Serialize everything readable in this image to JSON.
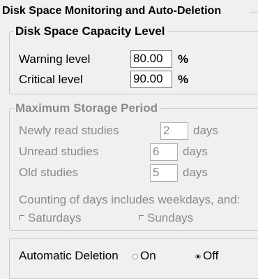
{
  "outer": {
    "title": "Disk Space Monitoring and Auto-Deletion"
  },
  "capacity": {
    "title": "Disk Space Capacity Level",
    "warning_label": "Warning level",
    "warning_value": "80.00",
    "critical_label": "Critical level",
    "critical_value": "90.00",
    "unit": "%"
  },
  "storage": {
    "title": "Maximum Storage Period",
    "newly_label": "Newly read studies",
    "newly_value": "2",
    "unread_label": "Unread studies",
    "unread_value": "6",
    "old_label": "Old studies",
    "old_value": "5",
    "days_unit": "days",
    "counting_text": "Counting of days includes weekdays, and:",
    "saturdays_label": "Saturdays",
    "sundays_label": "Sundays"
  },
  "auto_deletion": {
    "label": "Automatic Deletion",
    "on_label": "On",
    "off_label": "Off",
    "selected": "Off"
  }
}
